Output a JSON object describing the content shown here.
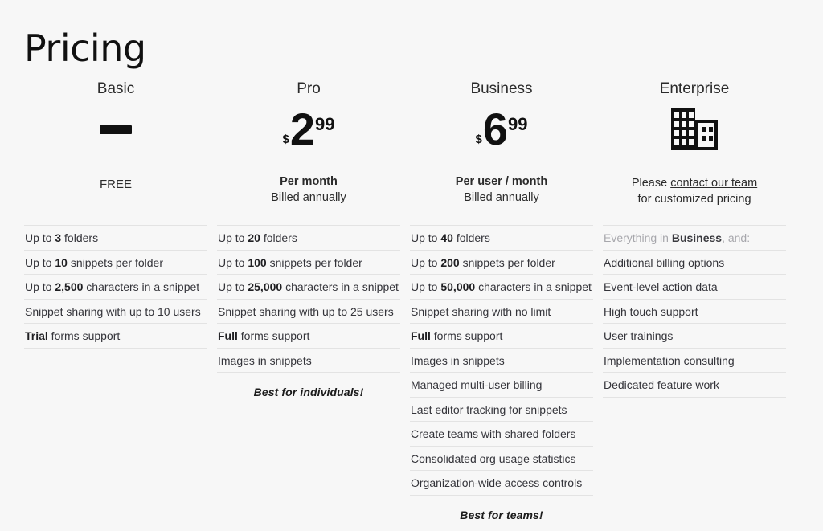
{
  "header": {
    "title": "Pricing"
  },
  "theme": {
    "background": "#f7f7f7",
    "text": "#2b2b2b",
    "muted": "#a7a7ac",
    "divider": "#e3e3e3",
    "accent": "#111111"
  },
  "plans": [
    {
      "name": "Basic",
      "price_type": "free-dash",
      "currency": "",
      "amount": "",
      "cents": "",
      "sub_primary": "",
      "sub_secondary": "",
      "free_label": "FREE",
      "features": [
        {
          "pre": "Up to ",
          "strong": "3",
          "post": " folders",
          "muted": false
        },
        {
          "pre": "Up to ",
          "strong": "10",
          "post": " snippets per folder",
          "muted": false
        },
        {
          "pre": "Up to ",
          "strong": "2,500",
          "post": " characters in a snippet",
          "muted": false
        },
        {
          "pre": "Snippet sharing with up to 10 users",
          "strong": "",
          "post": "",
          "muted": false
        },
        {
          "pre": "",
          "strong": "Trial",
          "post": " forms support",
          "muted": false
        }
      ],
      "tagline": ""
    },
    {
      "name": "Pro",
      "price_type": "amount",
      "currency": "$",
      "amount": "2",
      "cents": "99",
      "sub_primary": "Per month",
      "sub_secondary": "Billed annually",
      "free_label": "",
      "features": [
        {
          "pre": "Up to ",
          "strong": "20",
          "post": " folders",
          "muted": false
        },
        {
          "pre": "Up to ",
          "strong": "100",
          "post": " snippets per folder",
          "muted": false
        },
        {
          "pre": "Up to ",
          "strong": "25,000",
          "post": " characters in a snippet",
          "muted": false
        },
        {
          "pre": "Snippet sharing with up to 25 users",
          "strong": "",
          "post": "",
          "muted": false
        },
        {
          "pre": "",
          "strong": "Full",
          "post": " forms support",
          "muted": false
        },
        {
          "pre": "Images in snippets",
          "strong": "",
          "post": "",
          "muted": false
        }
      ],
      "tagline": "Best for individuals!"
    },
    {
      "name": "Business",
      "price_type": "amount",
      "currency": "$",
      "amount": "6",
      "cents": "99",
      "sub_primary": "Per user / month",
      "sub_secondary": "Billed annually",
      "free_label": "",
      "features": [
        {
          "pre": "Up to ",
          "strong": "40",
          "post": " folders",
          "muted": false
        },
        {
          "pre": "Up to ",
          "strong": "200",
          "post": " snippets per folder",
          "muted": false
        },
        {
          "pre": "Up to ",
          "strong": "50,000",
          "post": " characters in a snippet",
          "muted": false
        },
        {
          "pre": "Snippet sharing with no limit",
          "strong": "",
          "post": "",
          "muted": false
        },
        {
          "pre": "",
          "strong": "Full",
          "post": " forms support",
          "muted": false
        },
        {
          "pre": "Images in snippets",
          "strong": "",
          "post": "",
          "muted": false
        },
        {
          "pre": "Managed multi-user billing",
          "strong": "",
          "post": "",
          "muted": false
        },
        {
          "pre": "Last editor tracking for snippets",
          "strong": "",
          "post": "",
          "muted": false
        },
        {
          "pre": "Create teams with shared folders",
          "strong": "",
          "post": "",
          "muted": false
        },
        {
          "pre": "Consolidated org usage statistics",
          "strong": "",
          "post": "",
          "muted": false
        },
        {
          "pre": "Organization-wide access controls",
          "strong": "",
          "post": "",
          "muted": false
        }
      ],
      "tagline": "Best for teams!"
    },
    {
      "name": "Enterprise",
      "price_type": "icon",
      "price_icon": "building-icon",
      "currency": "",
      "amount": "",
      "cents": "",
      "sub_primary": "",
      "sub_secondary": "",
      "free_label": "",
      "contact": {
        "prefix": "Please ",
        "link": "contact our team",
        "suffix_line": "for customized pricing"
      },
      "features": [
        {
          "pre": "Everything in ",
          "strong": "Business",
          "post": ", and:",
          "muted": true
        },
        {
          "pre": "Additional billing options",
          "strong": "",
          "post": "",
          "muted": false
        },
        {
          "pre": "Event-level action data",
          "strong": "",
          "post": "",
          "muted": false
        },
        {
          "pre": "High touch support",
          "strong": "",
          "post": "",
          "muted": false
        },
        {
          "pre": "User trainings",
          "strong": "",
          "post": "",
          "muted": false
        },
        {
          "pre": "Implementation consulting",
          "strong": "",
          "post": "",
          "muted": false
        },
        {
          "pre": "Dedicated feature work",
          "strong": "",
          "post": "",
          "muted": false
        }
      ],
      "tagline": ""
    }
  ]
}
